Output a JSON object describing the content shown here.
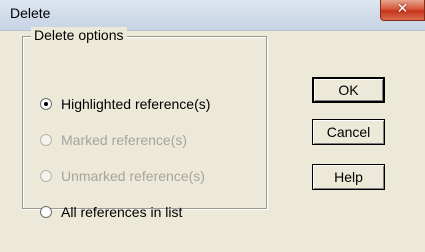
{
  "window": {
    "title": "Delete",
    "close_glyph": "✕"
  },
  "options_group": {
    "label": "Delete options",
    "items": [
      {
        "label": "Highlighted reference(s)",
        "checked": true,
        "enabled": true
      },
      {
        "label": "Marked reference(s)",
        "checked": false,
        "enabled": false
      },
      {
        "label": "Unmarked reference(s)",
        "checked": false,
        "enabled": false
      },
      {
        "label": "All references in list",
        "checked": false,
        "enabled": true
      }
    ]
  },
  "buttons": {
    "ok": "OK",
    "cancel": "Cancel",
    "help": "Help"
  },
  "colors": {
    "dialog_bg": "#ece9d8",
    "close_button": "#c5361b",
    "disabled_text": "#a7a59b"
  },
  "icons": {
    "close": "close-icon",
    "radio_selected": "radio-selected-icon",
    "radio_empty": "radio-empty-icon"
  }
}
